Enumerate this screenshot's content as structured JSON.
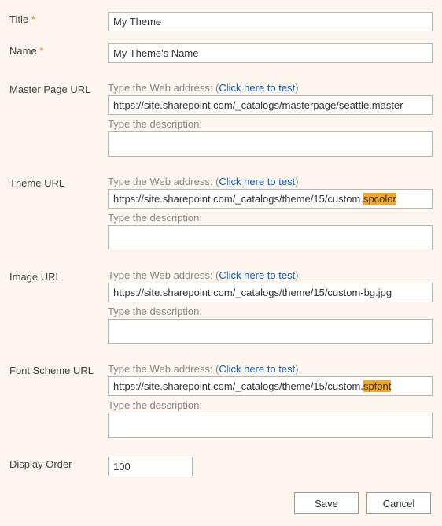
{
  "title": {
    "label": "Title",
    "required": "*",
    "value": "My Theme"
  },
  "name": {
    "label": "Name",
    "required": "*",
    "value": "My Theme's Name"
  },
  "prompts": {
    "address": "Type the Web address: (",
    "test": "Click here to test",
    "close": ")",
    "description": "Type the description:"
  },
  "masterPage": {
    "label": "Master Page URL",
    "url": "https://site.sharepoint.com/_catalogs/masterpage/seattle.master",
    "description": ""
  },
  "theme": {
    "label": "Theme URL",
    "url_prefix": "https://site.sharepoint.com/_catalogs/theme/15/custom.",
    "url_highlight": "spcolor",
    "description": ""
  },
  "image": {
    "label": "Image URL",
    "url": "https://site.sharepoint.com/_catalogs/theme/15/custom-bg.jpg",
    "description": ""
  },
  "fontScheme": {
    "label": "Font Scheme URL",
    "url_prefix": "https://site.sharepoint.com/_catalogs/theme/15/custom.",
    "url_highlight": "spfont",
    "description": ""
  },
  "displayOrder": {
    "label": "Display Order",
    "value": "100"
  },
  "buttons": {
    "save": "Save",
    "cancel": "Cancel"
  }
}
